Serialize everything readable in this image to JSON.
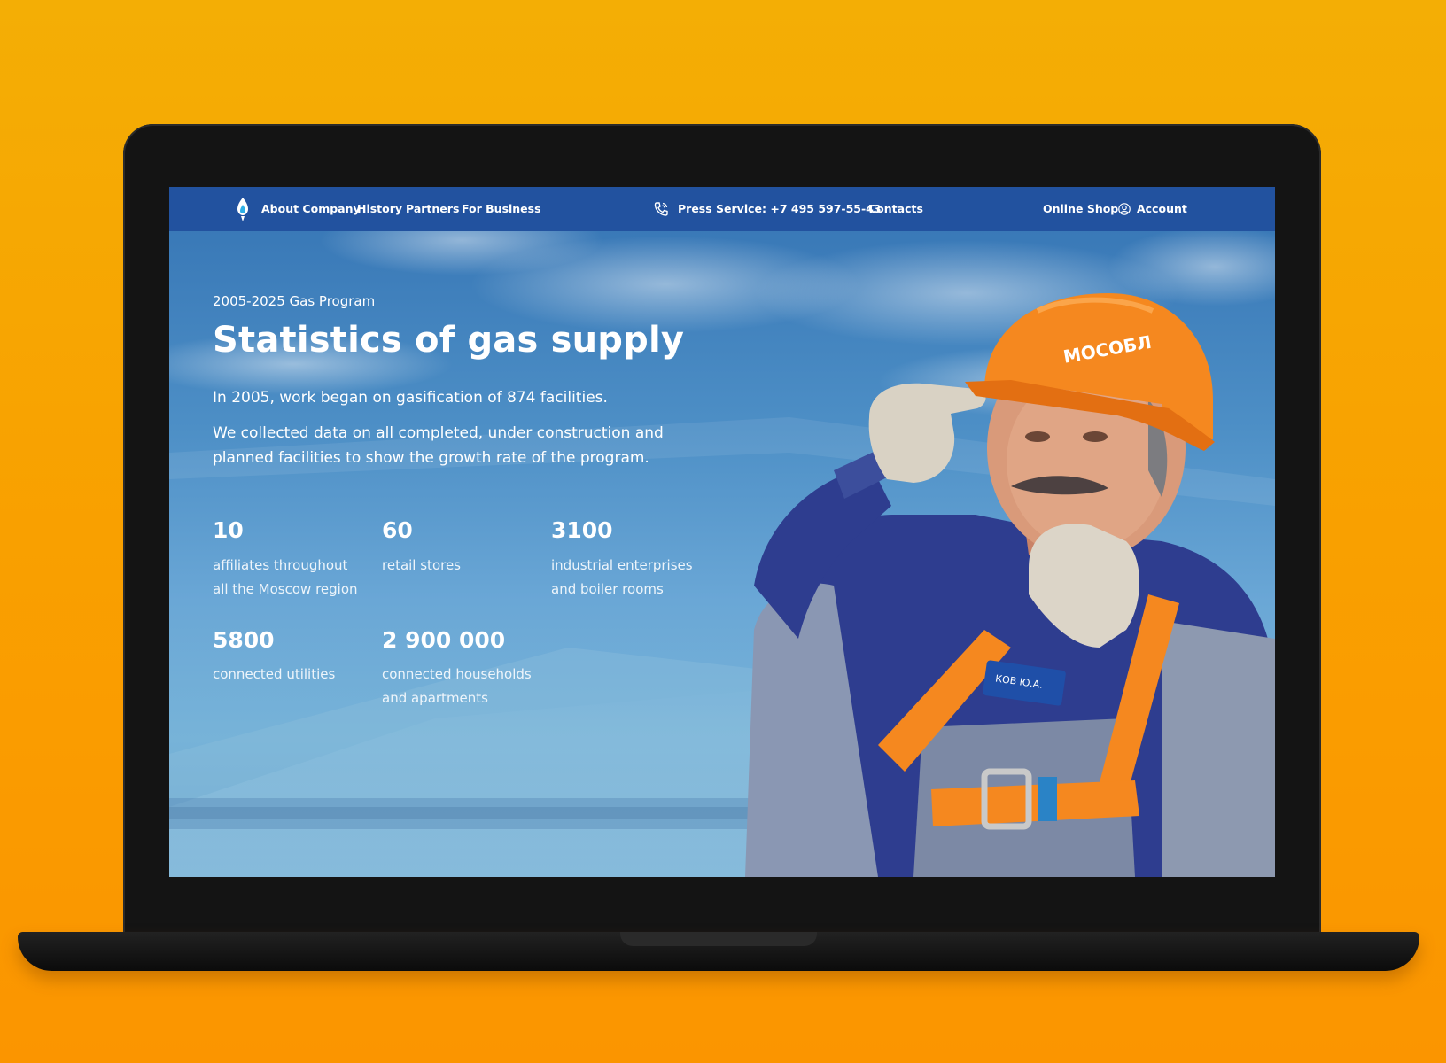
{
  "nav": {
    "left_items": [
      "About Company",
      "History",
      "Partners",
      "For Business"
    ],
    "press_service": "Press Service: +7 495 597-55-43",
    "contacts": "Contacts",
    "online_shop": "Online Shop",
    "account": "Account"
  },
  "hero": {
    "eyebrow": "2005-2025 Gas Program",
    "title": "Statistics of gas supply",
    "lead": "In 2005, work began on gasification of 874 facilities.",
    "para_line1": "We collected data on all completed, under construction and",
    "para_line2": "planned facilities to show the growth rate of the program."
  },
  "stats": [
    {
      "value": "10",
      "label1": "affiliates throughout",
      "label2": "all the Moscow region"
    },
    {
      "value": "60",
      "label1": "retail stores",
      "label2": ""
    },
    {
      "value": "3100",
      "label1": "industrial enterprises",
      "label2": "and boiler rooms"
    },
    {
      "value": "5800",
      "label1": "connected utilities",
      "label2": ""
    },
    {
      "value": "2 900 000",
      "label1": "connected households",
      "label2": "and apartments"
    }
  ],
  "photo": {
    "helmet_text": "МОСОБЛ",
    "badge_text": "КОВ Ю.А."
  },
  "colors": {
    "background": "#f9a000",
    "navbar": "#22529f",
    "sky": "#4d8fc6",
    "helmet": "#f5881f",
    "uniform": "#2e3d8f"
  },
  "icons": [
    "logo-icon",
    "phone-icon",
    "account-icon"
  ]
}
